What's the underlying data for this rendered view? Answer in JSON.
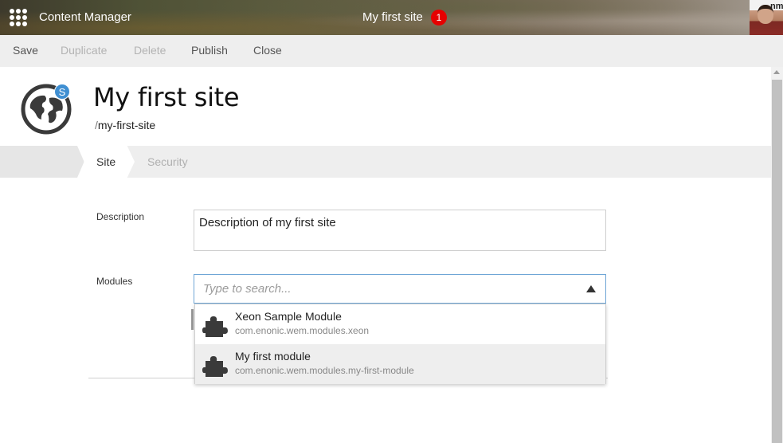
{
  "header": {
    "app_title": "Content Manager",
    "tab_title": "My first site",
    "tab_badge": "1",
    "avatar_text": "nml"
  },
  "toolbar": {
    "save_label": "Save",
    "duplicate_label": "Duplicate",
    "delete_label": "Delete",
    "publish_label": "Publish",
    "close_label": "Close"
  },
  "content": {
    "site_badge": "S",
    "title": "My first site",
    "path_slash": "/",
    "path": "my-first-site"
  },
  "steps": [
    {
      "label": "Site",
      "active": true
    },
    {
      "label": "Security",
      "active": false
    }
  ],
  "form": {
    "description_label": "Description",
    "description_value": "Description of my first site",
    "modules_label": "Modules",
    "modules_placeholder": "Type to search..."
  },
  "dropdown": {
    "options": [
      {
        "name": "Xeon Sample Module",
        "path": "com.enonic.wem.modules.xeon"
      },
      {
        "name": "My first module",
        "path": "com.enonic.wem.modules.my-first-module"
      }
    ]
  },
  "colors": {
    "accent": "#3f8fd2",
    "badge": "#e60000",
    "toolbar_bg": "#eeeeee",
    "icon_dark": "#3a3a3a"
  }
}
